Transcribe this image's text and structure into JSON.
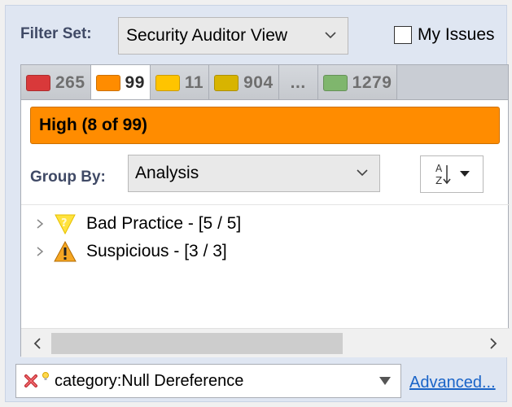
{
  "filter": {
    "label": "Filter Set:",
    "selected": "Security Auditor View",
    "my_issues_label": "My Issues"
  },
  "tabs": [
    {
      "count": "265",
      "color": "#d9393a"
    },
    {
      "count": "99",
      "color": "#ff8c00",
      "active": true
    },
    {
      "count": "11",
      "color": "#ffc400"
    },
    {
      "count": "904",
      "color": "#d8b400"
    },
    {
      "count": "...",
      "color": null
    },
    {
      "count": "1279",
      "color": "#7fb66d"
    }
  ],
  "priority_bar": {
    "text": "High (8 of 99)",
    "color": "#ff8c00"
  },
  "group_by": {
    "label": "Group By:",
    "selected": "Analysis"
  },
  "tree": [
    {
      "label": "Bad Practice - [5 / 5]",
      "icon": "bad-practice-icon"
    },
    {
      "label": "Suspicious - [3 / 3]",
      "icon": "warning-icon"
    }
  ],
  "search": {
    "value": "category:Null Dereference"
  },
  "advanced_link": "Advanced..."
}
